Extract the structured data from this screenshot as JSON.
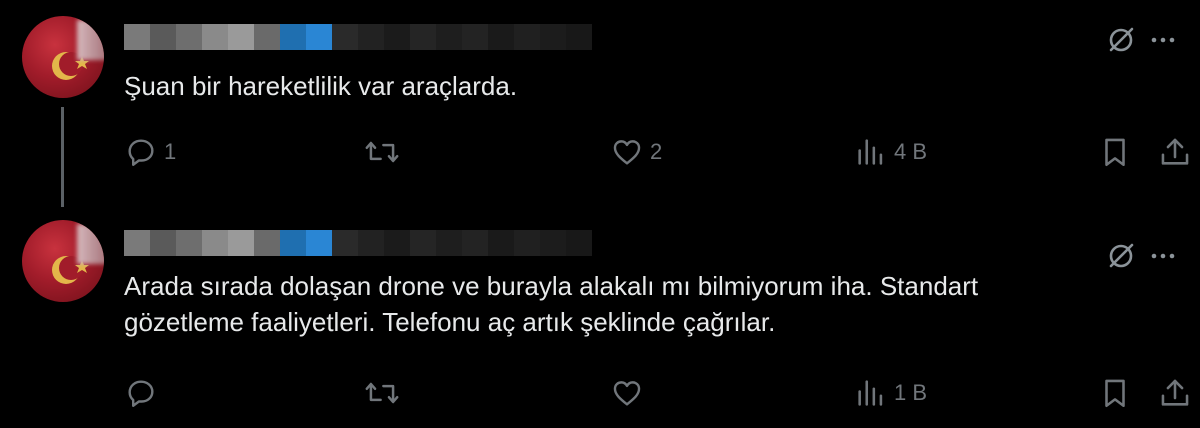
{
  "tweets": [
    {
      "text": "Şuan bir hareketlilik var araçlarda.",
      "reply_count": "1",
      "retweet_count": "",
      "like_count": "2",
      "view_count": "4 B",
      "has_thread_line": true
    },
    {
      "text": "Arada sırada dolaşan drone ve burayla alakalı mı bilmiyorum iha. Standart\ngözetleme faaliyetleri. Telefonu aç artık şeklinde çağrılar.",
      "reply_count": "",
      "retweet_count": "",
      "like_count": "",
      "view_count": "1 B",
      "has_thread_line": false
    }
  ],
  "icons": {
    "reply": "reply-icon",
    "retweet": "retweet-icon",
    "like": "heart-icon",
    "views": "views-icon",
    "bookmark": "bookmark-icon",
    "share": "share-icon",
    "grok": "grok-icon",
    "more": "more-icon"
  },
  "colors": {
    "background": "#000000",
    "text": "#e7e9ea",
    "muted": "#71767b",
    "thread_line": "#5b6166"
  }
}
